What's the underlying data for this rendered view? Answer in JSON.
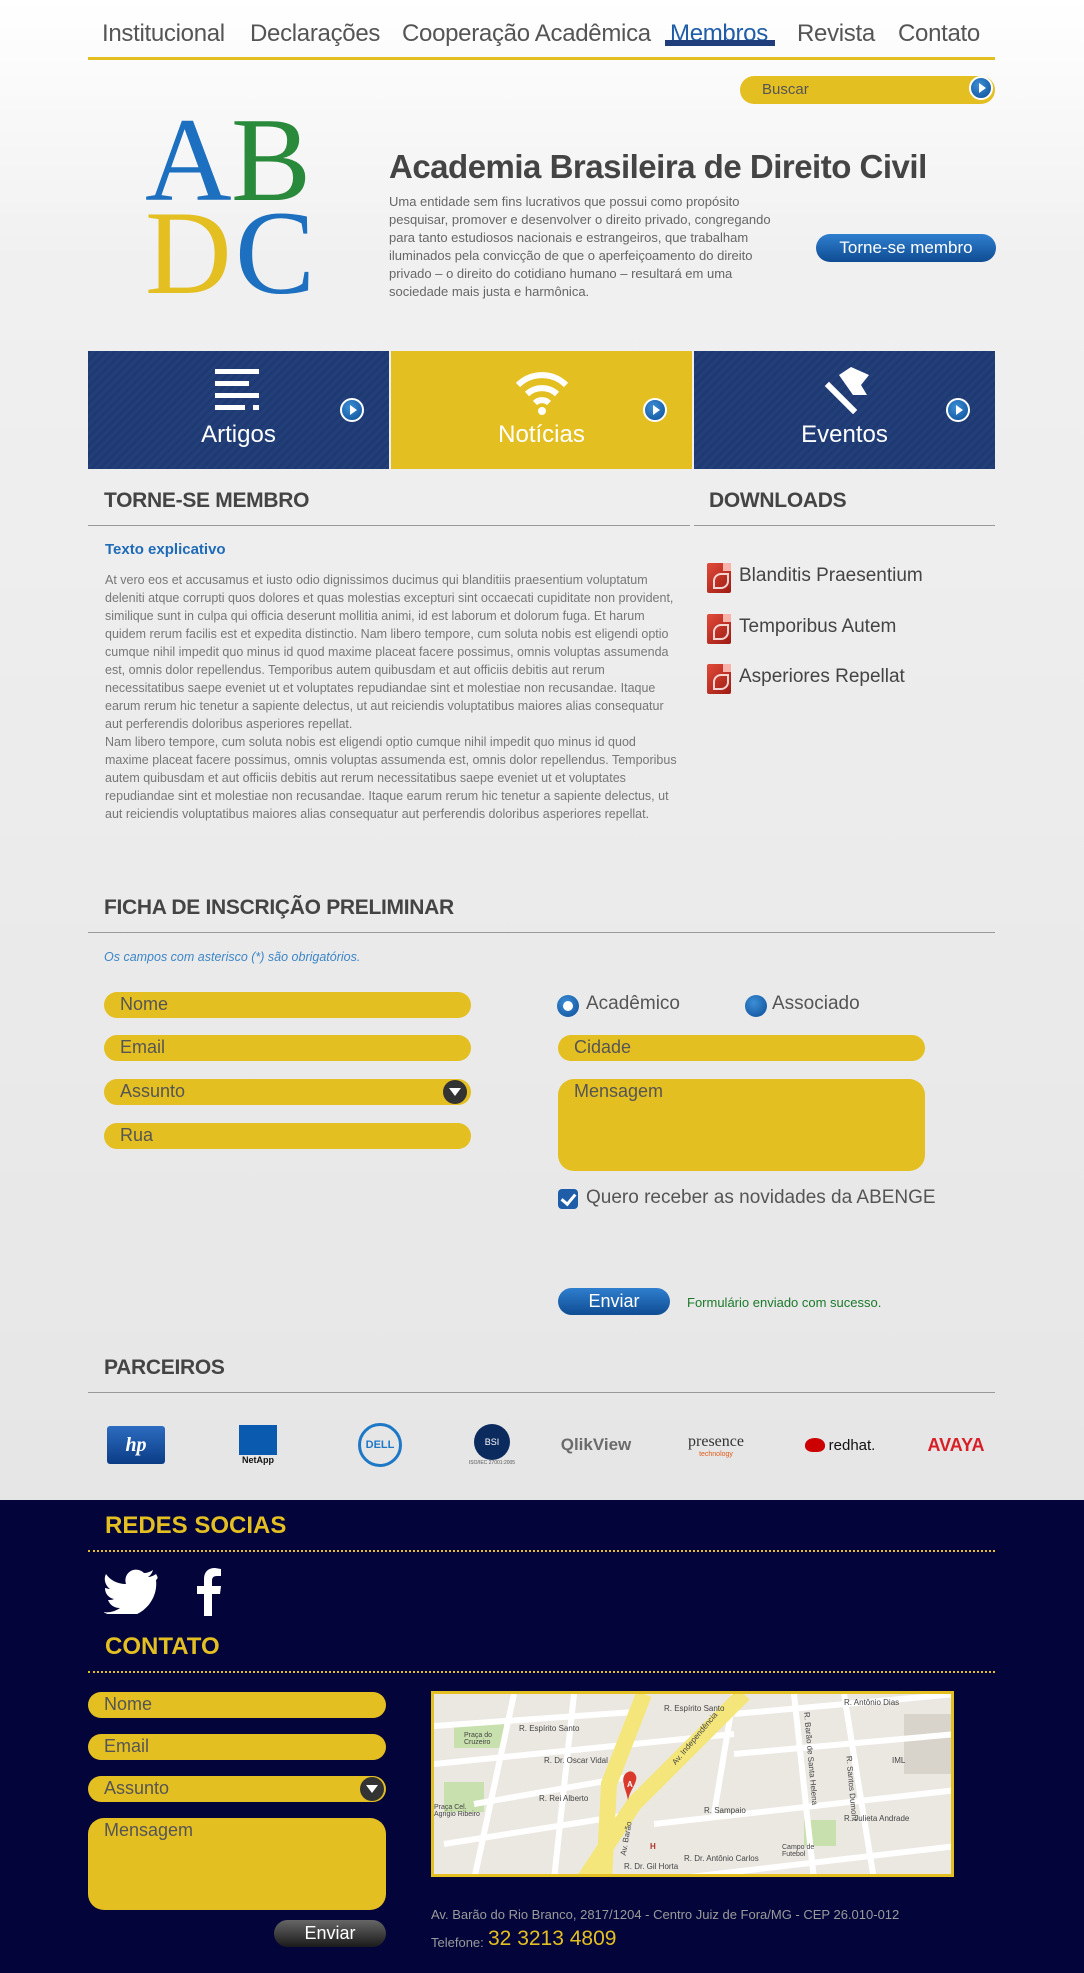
{
  "nav": {
    "items": [
      "Institucional",
      "Declarações",
      "Cooperação Acadêmica",
      "Membros",
      "Revista",
      "Contato"
    ],
    "active": "Membros"
  },
  "search": {
    "label": "Buscar"
  },
  "logo": {
    "letters": [
      "A",
      "B",
      "D",
      "C"
    ]
  },
  "header": {
    "title": "Academia Brasileira de Direito Civil",
    "description": "Uma entidade sem fins lucrativos que possui como propósito pesquisar, promover e desenvolver o direito privado, congregando para tanto estudiosos nacionais e estrangeiros, que trabalham iluminados pela convicção de que o aperfeiçoamento do direito privado – o direito do cotidiano humano – resultará em uma sociedade mais justa e harmônica.",
    "member_button": "Torne-se membro"
  },
  "tiles": [
    {
      "label": "Artigos",
      "icon": "lines-icon"
    },
    {
      "label": "Notícias",
      "icon": "wifi-icon"
    },
    {
      "label": "Eventos",
      "icon": "flag-icon"
    }
  ],
  "member_section": {
    "title": "TORNE-SE MEMBRO",
    "subhead": "Texto explicativo",
    "body": "At vero eos et accusamus et iusto odio dignissimos ducimus qui blanditiis praesentium voluptatum deleniti atque corrupti quos dolores et quas molestias excepturi sint occaecati cupiditate non provident, similique sunt in culpa qui officia deserunt mollitia animi, id est laborum et dolorum fuga. Et harum quidem rerum facilis est et expedita distinctio. Nam libero tempore, cum soluta nobis est eligendi optio cumque nihil impedit quo minus id quod maxime placeat facere possimus, omnis voluptas assumenda est, omnis dolor repellendus. Temporibus autem quibusdam et aut officiis debitis aut rerum necessitatibus saepe eveniet ut et voluptates repudiandae sint et molestiae non recusandae. Itaque earum rerum hic tenetur a sapiente delectus, ut aut reiciendis voluptatibus maiores alias consequatur aut perferendis doloribus asperiores repellat.",
    "body2": "Nam libero tempore, cum soluta nobis est eligendi optio cumque nihil impedit quo minus id quod maxime placeat facere possimus, omnis voluptas assumenda est, omnis dolor repellendus. Temporibus autem quibusdam et aut officiis debitis aut rerum necessitatibus saepe eveniet ut et voluptates repudiandae sint et molestiae non recusandae. Itaque earum rerum hic tenetur a sapiente delectus, ut aut reiciendis voluptatibus maiores alias consequatur aut perferendis doloribus asperiores repellat."
  },
  "downloads": {
    "title": "DOWNLOADS",
    "items": [
      "Blanditis Praesentium",
      "Temporibus Autem",
      "Asperiores Repellat"
    ]
  },
  "form": {
    "title": "FICHA DE INSCRIÇÃO PRELIMINAR",
    "note": "Os campos com asterisco (*) são obrigatórios.",
    "placeholders": {
      "nome": "Nome",
      "email": "Email",
      "assunto": "Assunto",
      "rua": "Rua",
      "cidade": "Cidade",
      "mensagem": "Mensagem"
    },
    "radio": {
      "academico": "Acadêmico",
      "associado": "Associado",
      "selected": "Acadêmico"
    },
    "checkbox_label": "Quero receber as novidades da ABENGE",
    "submit": "Enviar",
    "success": "Formulário enviado com sucesso."
  },
  "partners": {
    "title": "PARCEIROS",
    "items": [
      "hp",
      "NetApp",
      "DELL",
      "BSI",
      "QlikView",
      "presence",
      "redhat.",
      "AVAYA"
    ],
    "bsi_sub": "ISO/IEC 27001:2005",
    "presence_sub": "technology"
  },
  "footer": {
    "social_title": "REDES SOCIAS",
    "social": [
      "twitter-icon",
      "facebook-icon"
    ],
    "contact_title": "CONTATO",
    "placeholders": {
      "nome": "Nome",
      "email": "Email",
      "assunto": "Assunto",
      "mensagem": "Mensagem"
    },
    "submit": "Enviar",
    "address": "Av. Barão do Rio Branco, 2817/1204 - Centro Juiz de Fora/MG - CEP 26.010-012",
    "phone_label": "Telefone:",
    "phone": "32 3213 4809"
  },
  "map": {
    "labels": [
      "R. Espírito Santo",
      "R. Espírito Santo",
      "Praça do Cruzeiro",
      "R. Dr. Oscar Vidal",
      "R. Rei Alberto",
      "Praça Cel. Agrigio Ribeiro",
      "Av. Independência",
      "Av. Barão",
      "R. Barão de Santa Helena",
      "R. Santos Dumont",
      "R. Antônio Dias",
      "R. Sampaio",
      "R. Julieta Andrade",
      "R. Dr. Antônio Carlos",
      "Campo de Futebol",
      "R. Dr. Gil Horta",
      "IML",
      "A",
      "H"
    ]
  },
  "colors": {
    "accent_yellow": "#e4bf22",
    "brand_blue": "#1f3a72",
    "footer_bg": "#03053a",
    "link_blue": "#1f6bb8"
  }
}
